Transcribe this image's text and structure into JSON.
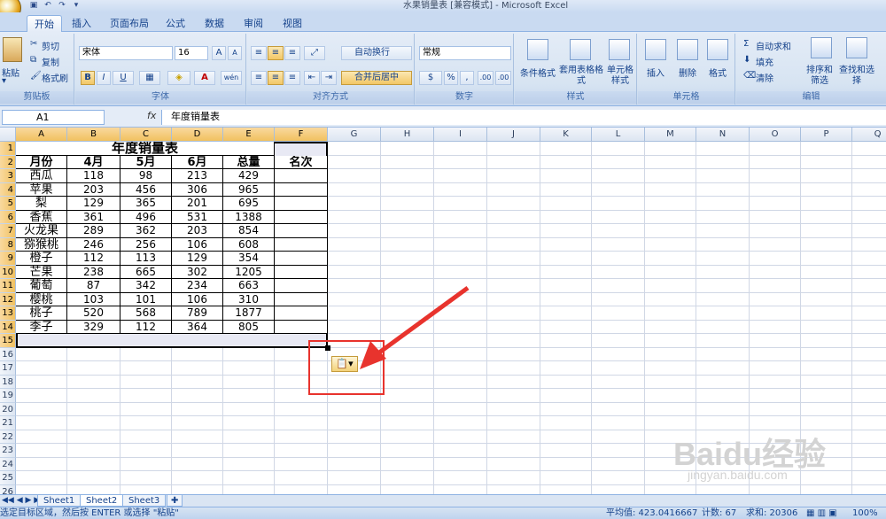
{
  "window": {
    "title": "水果销量表  [兼容模式] - Microsoft Excel"
  },
  "tabs": [
    "开始",
    "插入",
    "页面布局",
    "公式",
    "数据",
    "审阅",
    "视图"
  ],
  "ribbon": {
    "clipboard": {
      "label": "剪贴板",
      "paste": "粘贴",
      "cut": "剪切",
      "copy": "复制",
      "format_painter": "格式刷"
    },
    "font": {
      "label": "字体",
      "name": "宋体",
      "size": "16",
      "bold": "B",
      "italic": "I",
      "underline": "U",
      "grow": "A",
      "shrink": "A",
      "phonetic": "wén"
    },
    "alignment": {
      "label": "对齐方式",
      "wrap": "自动换行",
      "merge": "合并后居中"
    },
    "number": {
      "label": "数字",
      "format": "常规",
      "percent": "%",
      "comma": ",",
      "inc_decimal": ".00",
      "dec_decimal": ".00"
    },
    "styles": {
      "label": "样式",
      "conditional": "条件格式",
      "table": "套用表格格式",
      "cell_styles": "单元格样式"
    },
    "cells": {
      "label": "单元格",
      "insert": "插入",
      "delete": "删除",
      "format": "格式"
    },
    "editing": {
      "label": "编辑",
      "autosum": "自动求和",
      "fill": "填充",
      "clear": "清除",
      "sort": "排序和筛选",
      "find": "查找和选择"
    }
  },
  "formula_bar": {
    "cell_ref": "A1",
    "fx": "fx",
    "formula": "年度销量表"
  },
  "columns": [
    "A",
    "B",
    "C",
    "D",
    "E",
    "F",
    "G",
    "H",
    "I",
    "J",
    "K",
    "L",
    "M",
    "N",
    "O",
    "P",
    "Q"
  ],
  "rows": [
    "1",
    "2",
    "3",
    "4",
    "5",
    "6",
    "7",
    "8",
    "9",
    "10",
    "11",
    "12",
    "13",
    "14",
    "15",
    "16",
    "17",
    "18",
    "19",
    "20",
    "21",
    "22",
    "23",
    "24",
    "25",
    "26"
  ],
  "table": {
    "title": "年度销量表",
    "headers": [
      "月份",
      "4月",
      "5月",
      "6月",
      "总量",
      "名次"
    ],
    "rows": [
      [
        "西瓜",
        "118",
        "98",
        "213",
        "429",
        ""
      ],
      [
        "苹果",
        "203",
        "456",
        "306",
        "965",
        ""
      ],
      [
        "梨",
        "129",
        "365",
        "201",
        "695",
        ""
      ],
      [
        "香蕉",
        "361",
        "496",
        "531",
        "1388",
        ""
      ],
      [
        "火龙果",
        "289",
        "362",
        "203",
        "854",
        ""
      ],
      [
        "猕猴桃",
        "246",
        "256",
        "106",
        "608",
        ""
      ],
      [
        "橙子",
        "112",
        "113",
        "129",
        "354",
        ""
      ],
      [
        "芒果",
        "238",
        "665",
        "302",
        "1205",
        ""
      ],
      [
        "葡萄",
        "87",
        "342",
        "234",
        "663",
        ""
      ],
      [
        "樱桃",
        "103",
        "101",
        "106",
        "310",
        ""
      ],
      [
        "桃子",
        "520",
        "568",
        "789",
        "1877",
        ""
      ],
      [
        "李子",
        "329",
        "112",
        "364",
        "805",
        ""
      ]
    ]
  },
  "sheets": [
    "Sheet1",
    "Sheet2",
    "Sheet3"
  ],
  "active_sheet": "Sheet2",
  "status": {
    "message": "选定目标区域，然后按 ENTER 或选择 \"粘贴\"",
    "average": "平均值: 423.0416667",
    "count": "计数: 67",
    "sum": "求和: 20306",
    "zoom": "100%"
  },
  "watermark": {
    "brand": "Baidu经验",
    "url": "jingyan.baidu.com"
  },
  "colors": {
    "accent": "#15428b",
    "highlight": "#e8332d",
    "selected_header": "#f1c15f"
  }
}
